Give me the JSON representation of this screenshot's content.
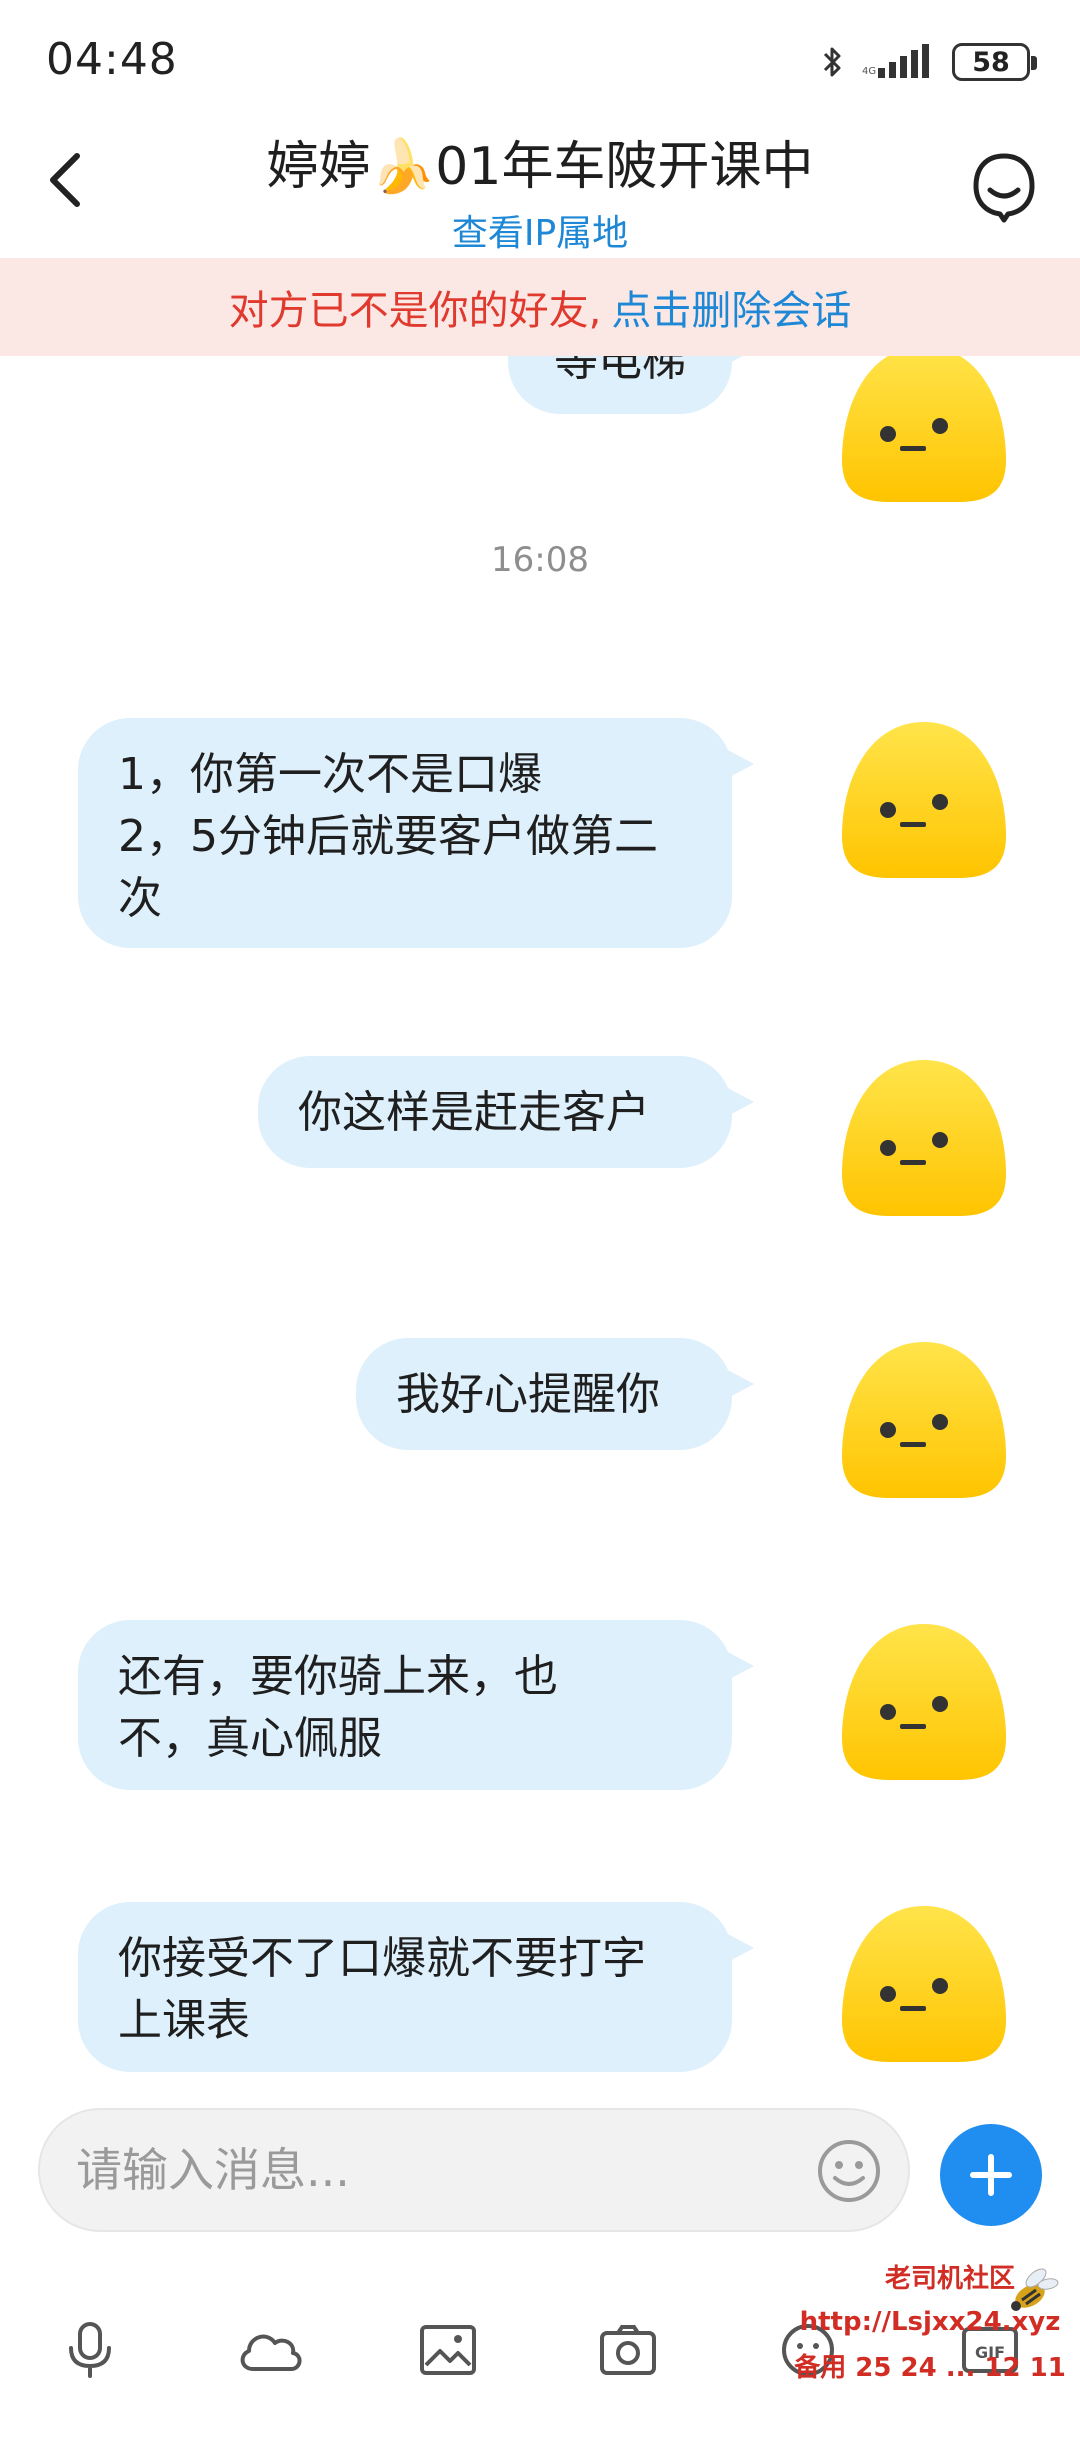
{
  "status_bar": {
    "time": "04:48",
    "battery": "58",
    "icons": [
      "bluetooth-icon",
      "signal-icon",
      "battery-icon"
    ]
  },
  "header": {
    "title": "婷婷🍌01年车陂开课中",
    "subtitle_link": "查看IP属地",
    "back_icon": "chevron-left-icon",
    "profile_icon": "profile-icon"
  },
  "banner": {
    "text": "对方已不是你的好友,",
    "link": "点击删除会话"
  },
  "messages": [
    {
      "type": "text",
      "sender": "self",
      "text": "等电梯"
    },
    {
      "type": "time",
      "text": "16:08"
    },
    {
      "type": "text",
      "sender": "self",
      "text": "1，你第一次不是口爆\n2，5分钟后就要客户做第二次"
    },
    {
      "type": "text",
      "sender": "self",
      "text": "你这样是赶走客户"
    },
    {
      "type": "text",
      "sender": "self",
      "text": "我好心提醒你"
    },
    {
      "type": "text",
      "sender": "self",
      "text": "还有，要你骑上来，也不，真心佩服"
    },
    {
      "type": "text",
      "sender": "self",
      "text": "你接受不了口爆就不要打字上课表"
    }
  ],
  "input": {
    "placeholder": "请输入消息..."
  },
  "toolbar": {
    "items": [
      "microphone-icon",
      "cloud-icon",
      "image-icon",
      "camera-icon",
      "emoji-icon",
      "gif-icon"
    ]
  },
  "watermark": {
    "line1": "老司机社区",
    "line2": "http://Lsjxx24.xyz",
    "line3": "备用 25 24 ... 12 11"
  },
  "colors": {
    "bubble": "#def0fc",
    "accent_blue": "#1e88d6",
    "banner_bg": "#fbe8e4",
    "banner_red": "#e03a2e",
    "avatar_yellow": "#ffd000"
  }
}
